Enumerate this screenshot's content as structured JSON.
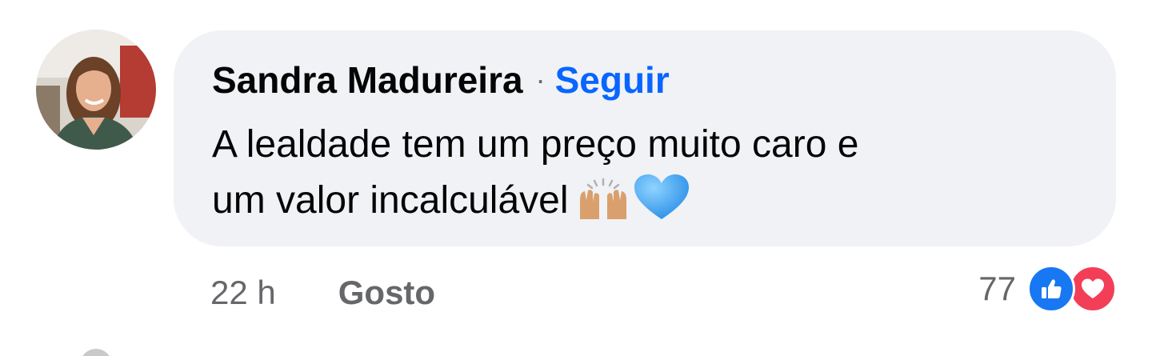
{
  "comment": {
    "author": "Sandra Madureira",
    "separator": "·",
    "follow_label": "Seguir",
    "text_line_1": "A lealdade tem um preço muito caro e",
    "text_line_2": "um valor incalculável",
    "emojis": [
      "raising-hands-emoji",
      "blue-heart-emoji"
    ],
    "time": "22 h",
    "like_label": "Gosto",
    "reaction_count": "77",
    "reactions": [
      "like-icon",
      "love-icon"
    ]
  },
  "colors": {
    "bubble": "#f0f2f5",
    "link": "#0866ff",
    "secondary_text": "#65676b",
    "like": "#1877f2",
    "love": "#f33e58"
  }
}
